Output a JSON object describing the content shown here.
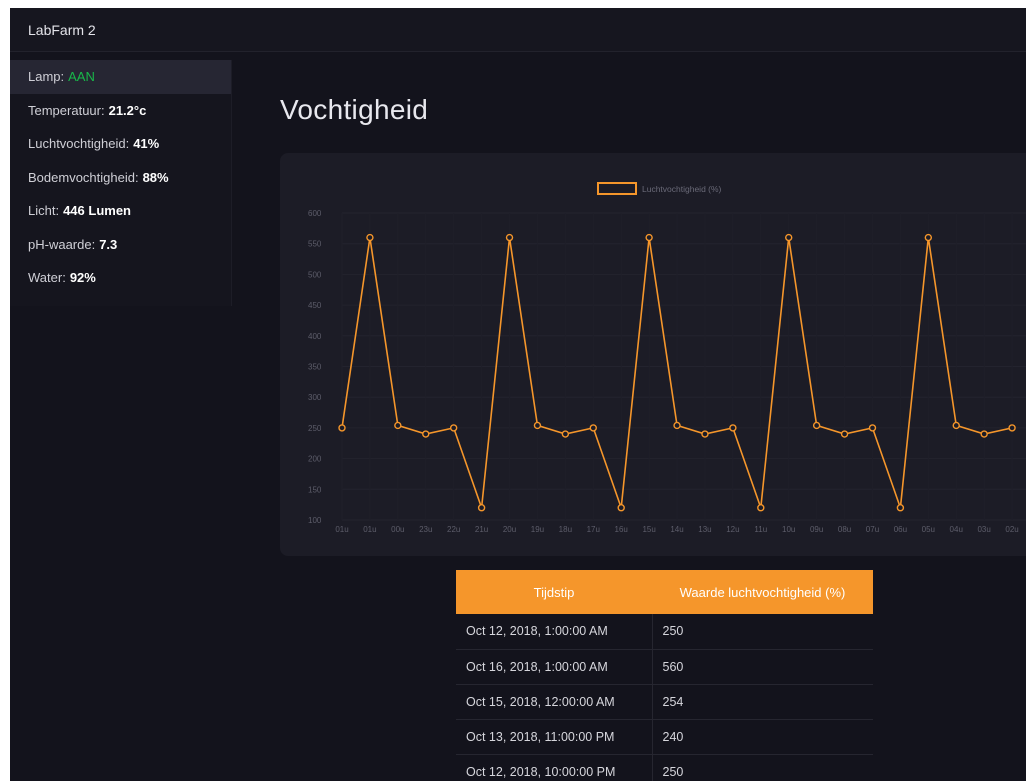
{
  "app": {
    "title": "LabFarm 2"
  },
  "sidebar": {
    "items": [
      {
        "label": "Lamp:",
        "value": "AAN"
      },
      {
        "label": "Temperatuur:",
        "value": "21.2°c"
      },
      {
        "label": "Luchtvochtigheid:",
        "value": "41%"
      },
      {
        "label": "Bodemvochtigheid:",
        "value": "88%"
      },
      {
        "label": "Licht:",
        "value": "446 Lumen"
      },
      {
        "label": "pH-waarde:",
        "value": "7.3"
      },
      {
        "label": "Water:",
        "value": "92%"
      }
    ]
  },
  "page": {
    "title": "Vochtigheid"
  },
  "colors": {
    "accent": "#f5962b",
    "lamp_on": "#18b84a",
    "background": "#13131c"
  },
  "chart_data": {
    "type": "line",
    "legend": "Luchtvochtigheid (%)",
    "legend_position": "top-center",
    "categories": [
      "01u",
      "01u",
      "00u",
      "23u",
      "22u",
      "21u",
      "20u",
      "19u",
      "18u",
      "17u",
      "16u",
      "15u",
      "14u",
      "13u",
      "12u",
      "11u",
      "10u",
      "09u",
      "08u",
      "07u",
      "06u",
      "05u",
      "04u",
      "03u",
      "02u"
    ],
    "series": [
      {
        "name": "Luchtvochtigheid (%)",
        "values": [
          250,
          560,
          254,
          240,
          250,
          120,
          560,
          254,
          240,
          250,
          120,
          560,
          254,
          240,
          250,
          120,
          560,
          254,
          240,
          250,
          120,
          560,
          254,
          240,
          250
        ]
      }
    ],
    "ylim": [
      100,
      600
    ],
    "yticks": [
      100,
      150,
      200,
      250,
      300,
      350,
      400,
      450,
      500,
      550,
      600
    ],
    "grid": true
  },
  "table": {
    "headers": [
      "Tijdstip",
      "Waarde luchtvochtigheid (%)"
    ],
    "rows": [
      [
        "Oct 12, 2018, 1:00:00 AM",
        "250"
      ],
      [
        "Oct 16, 2018, 1:00:00 AM",
        "560"
      ],
      [
        "Oct 15, 2018, 12:00:00 AM",
        "254"
      ],
      [
        "Oct 13, 2018, 11:00:00 PM",
        "240"
      ],
      [
        "Oct 12, 2018, 10:00:00 PM",
        "250"
      ]
    ]
  }
}
